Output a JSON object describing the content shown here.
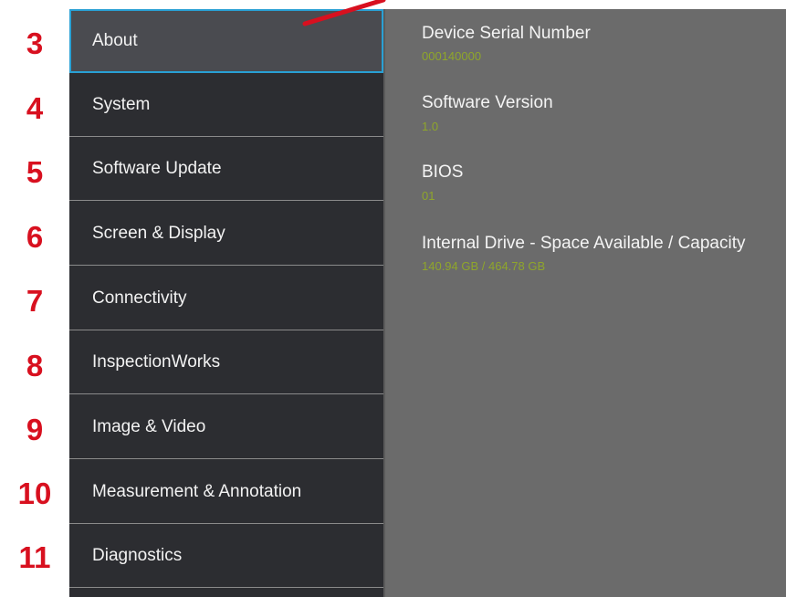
{
  "callouts": [
    "3",
    "4",
    "5",
    "6",
    "7",
    "8",
    "9",
    "10",
    "11"
  ],
  "sidebar": {
    "items": [
      {
        "label": "About",
        "selected": true
      },
      {
        "label": "System"
      },
      {
        "label": "Software Update"
      },
      {
        "label": "Screen & Display"
      },
      {
        "label": "Connectivity"
      },
      {
        "label": "InspectionWorks"
      },
      {
        "label": "Image & Video"
      },
      {
        "label": "Measurement & Annotation"
      },
      {
        "label": "Diagnostics"
      }
    ]
  },
  "about": {
    "serial_label": "Device Serial Number",
    "serial_value": "000140000",
    "software_label": "Software Version",
    "software_value": "1.0",
    "bios_label": "BIOS",
    "bios_value": "01",
    "drive_label": "Internal Drive - Space Available / Capacity",
    "drive_value": "140.94 GB / 464.78 GB"
  },
  "colors": {
    "callout": "#d8101f",
    "selection_border": "#29a0d4",
    "value_text": "#8fa62b",
    "sidebar_bg": "#2c2d31",
    "content_bg": "#6b6b6b"
  }
}
